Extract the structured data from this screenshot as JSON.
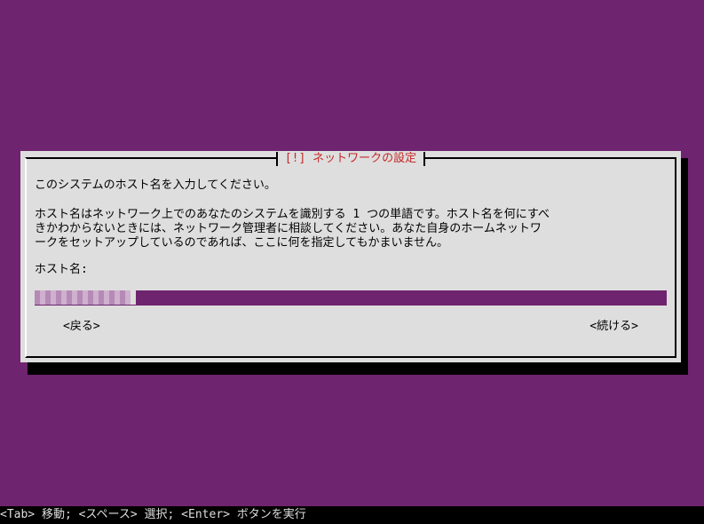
{
  "dialog": {
    "title": "[!] ネットワークの設定",
    "prompt": "このシステムのホスト名を入力してください。",
    "description_lines": [
      "ホスト名はネットワーク上でのあなたのシステムを識別する 1 つの単語です。ホスト名を何にすべ",
      "きかわからないときには、ネットワーク管理者に相談してください。あなた自身のホームネットワ",
      "ークをセットアップしているのであれば、ここに何を指定してもかまいません。"
    ],
    "field_label": "ホスト名:",
    "field_value": "",
    "back_button": "<戻る>",
    "continue_button": "<続ける>"
  },
  "statusbar": {
    "text": "<Tab> 移動; <スペース> 選択; <Enter> ボタンを実行"
  },
  "colors": {
    "background": "#6f246f",
    "dialog": "#dedede",
    "title": "#c62828",
    "statusbar": "#000000"
  }
}
